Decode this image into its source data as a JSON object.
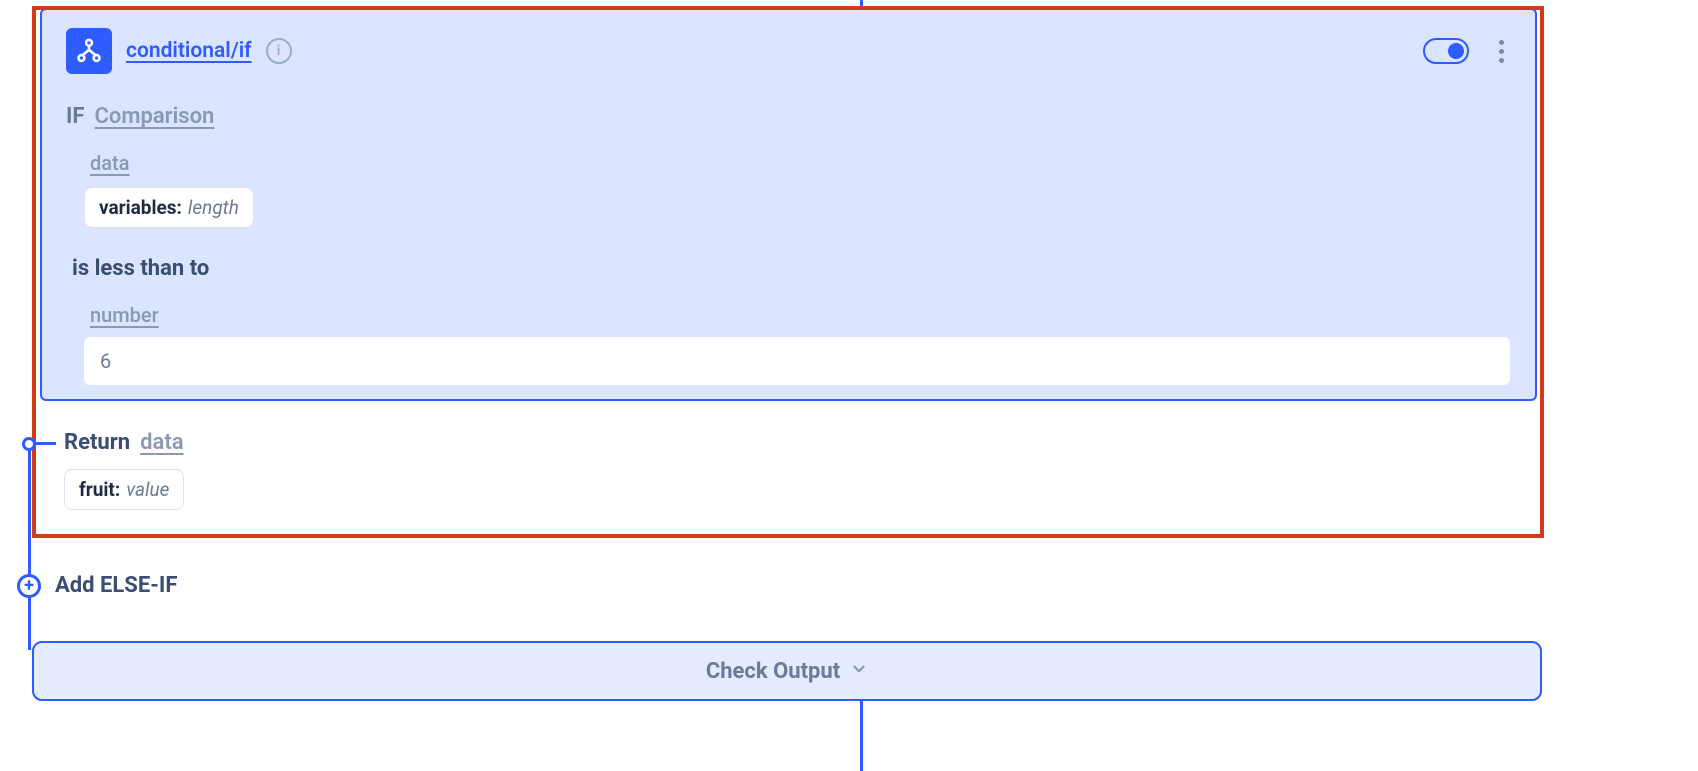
{
  "node": {
    "title": "conditional/if",
    "toggle_on": true
  },
  "condition": {
    "if_keyword": "IF",
    "type_label": "Comparison",
    "left": {
      "label": "data",
      "chip_key": "variables:",
      "chip_value": "length"
    },
    "operator": "is less than to",
    "right": {
      "label": "number",
      "value": "6"
    }
  },
  "return": {
    "keyword": "Return",
    "label": "data",
    "chip_key": "fruit:",
    "chip_value": "value"
  },
  "actions": {
    "add_elseif": "Add ELSE-IF",
    "check_output": "Check Output"
  }
}
